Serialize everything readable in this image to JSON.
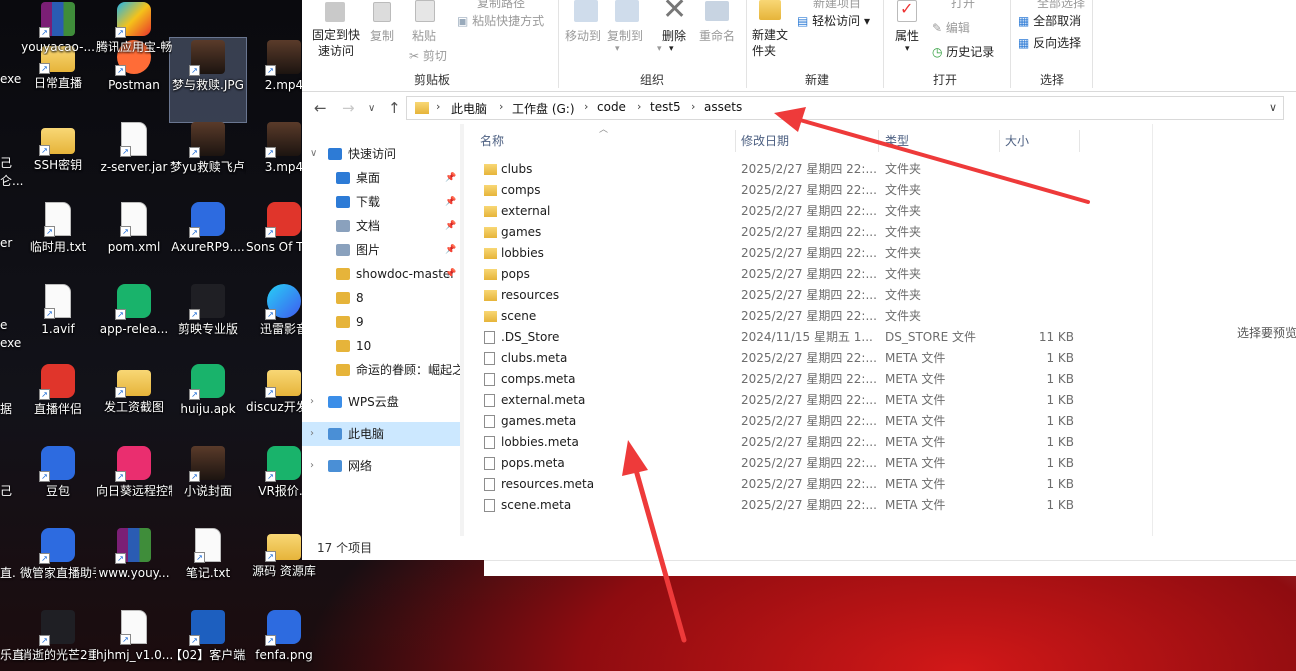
{
  "desktop": {
    "icons": [
      {
        "label": "日常直播",
        "type": "folder"
      },
      {
        "label": "Postman",
        "type": "orange"
      },
      {
        "label": "梦与救赎.JPG",
        "type": "img"
      },
      {
        "label": "2.mp4",
        "type": "img"
      },
      {
        "label": "SSH密钥",
        "type": "folder"
      },
      {
        "label": "z-server.jar",
        "type": "file"
      },
      {
        "label": "梦yu救赎飞卢.png",
        "type": "img"
      },
      {
        "label": "3.mp4",
        "type": "img"
      },
      {
        "label": "临时用.txt",
        "type": "file"
      },
      {
        "label": "pom.xml",
        "type": "file"
      },
      {
        "label": "AxureRP9....",
        "type": "blue"
      },
      {
        "label": "Sons Of The Forest",
        "type": "red"
      },
      {
        "label": "1.avif",
        "type": "file"
      },
      {
        "label": "app-relea...",
        "type": "green"
      },
      {
        "label": "剪映专业版",
        "type": "dark"
      },
      {
        "label": "迅雷影音",
        "type": "cyan"
      },
      {
        "label": "直播伴侣",
        "type": "red"
      },
      {
        "label": "发工资截图",
        "type": "folder"
      },
      {
        "label": "huiju.apk",
        "type": "green"
      },
      {
        "label": "discuz开发者中心",
        "type": "folder"
      },
      {
        "label": "豆包",
        "type": "blue"
      },
      {
        "label": "向日葵远程控制",
        "type": "pink"
      },
      {
        "label": "小说封面",
        "type": "img"
      },
      {
        "label": "VR报价.x",
        "type": "green"
      },
      {
        "label": "微管家直播助手",
        "type": "blue"
      },
      {
        "label": "www.youy...",
        "type": "rar"
      },
      {
        "label": "笔记.txt",
        "type": "file"
      },
      {
        "label": "源码 资源库",
        "type": "folder"
      },
      {
        "label": "消逝的光芒2重装上阵版",
        "type": "dark"
      },
      {
        "label": "hjhmj_v1.0...",
        "type": "file"
      },
      {
        "label": "【02】客户端服务端C...",
        "type": "word"
      },
      {
        "label": "fenfa.png",
        "type": "blue"
      },
      {
        "label": "youyacao-...",
        "type": "rar"
      },
      {
        "label": "腾讯应用宝-畅玩手机...",
        "type": "lt"
      }
    ],
    "edge_labels": [
      "exe",
      "己",
      "仑...",
      "er",
      "e",
      "exe",
      "据",
      "己",
      "直.",
      "乐直"
    ]
  },
  "ribbon": {
    "top_partial": [
      "复制路径",
      "新建项目",
      "打开",
      "全部选择"
    ],
    "pin": "固定到快速访问",
    "copy": "复制",
    "paste": "粘贴",
    "paste_shortcut": "粘贴快捷方式",
    "cut": "剪切",
    "move_to": "移动到",
    "copy_to": "复制到",
    "delete": "删除",
    "rename": "重命名",
    "new_folder": "新建文件夹",
    "easy_access": "轻松访问",
    "properties": "属性",
    "edit": "编辑",
    "history": "历史记录",
    "select_none": "全部取消",
    "invert": "反向选择",
    "groups": [
      "剪贴板",
      "组织",
      "新建",
      "打开",
      "选择"
    ]
  },
  "address": {
    "crumbs": [
      "此电脑",
      "工作盘 (G:)",
      "code",
      "test5",
      "assets"
    ]
  },
  "nav": {
    "items": [
      {
        "label": "快速访问",
        "kind": "quick",
        "indent": 0,
        "arrow": "open"
      },
      {
        "label": "桌面",
        "kind": "desktop",
        "indent": 1,
        "pin": true
      },
      {
        "label": "下载",
        "kind": "download",
        "indent": 1,
        "pin": true
      },
      {
        "label": "文档",
        "kind": "docs",
        "indent": 1,
        "pin": true
      },
      {
        "label": "图片",
        "kind": "pics",
        "indent": 1,
        "pin": true
      },
      {
        "label": "showdoc-master",
        "kind": "folder",
        "indent": 1,
        "pin": true
      },
      {
        "label": "8",
        "kind": "folder",
        "indent": 1
      },
      {
        "label": "9",
        "kind": "folder",
        "indent": 1
      },
      {
        "label": "10",
        "kind": "folder",
        "indent": 1
      },
      {
        "label": "命运的眷顾：崛起之路",
        "kind": "folder",
        "indent": 1
      },
      {
        "label": "WPS云盘",
        "kind": "cloud",
        "indent": 0,
        "arrow": "closed"
      },
      {
        "label": "此电脑",
        "kind": "pc",
        "indent": 0,
        "arrow": "closed",
        "selected": true
      },
      {
        "label": "网络",
        "kind": "net",
        "indent": 0,
        "arrow": "closed"
      }
    ]
  },
  "list": {
    "headers": [
      "名称",
      "修改日期",
      "类型",
      "大小"
    ],
    "rows": [
      {
        "name": "clubs",
        "date": "2025/2/27 星期四 22:...",
        "type": "文件夹",
        "size": "",
        "kind": "folder"
      },
      {
        "name": "comps",
        "date": "2025/2/27 星期四 22:...",
        "type": "文件夹",
        "size": "",
        "kind": "folder"
      },
      {
        "name": "external",
        "date": "2025/2/27 星期四 22:...",
        "type": "文件夹",
        "size": "",
        "kind": "folder"
      },
      {
        "name": "games",
        "date": "2025/2/27 星期四 22:...",
        "type": "文件夹",
        "size": "",
        "kind": "folder"
      },
      {
        "name": "lobbies",
        "date": "2025/2/27 星期四 22:...",
        "type": "文件夹",
        "size": "",
        "kind": "folder"
      },
      {
        "name": "pops",
        "date": "2025/2/27 星期四 22:...",
        "type": "文件夹",
        "size": "",
        "kind": "folder"
      },
      {
        "name": "resources",
        "date": "2025/2/27 星期四 22:...",
        "type": "文件夹",
        "size": "",
        "kind": "folder"
      },
      {
        "name": "scene",
        "date": "2025/2/27 星期四 22:...",
        "type": "文件夹",
        "size": "",
        "kind": "folder"
      },
      {
        "name": ".DS_Store",
        "date": "2024/11/15 星期五 1...",
        "type": "DS_STORE 文件",
        "size": "11 KB",
        "kind": "file"
      },
      {
        "name": "clubs.meta",
        "date": "2025/2/27 星期四 22:...",
        "type": "META 文件",
        "size": "1 KB",
        "kind": "file"
      },
      {
        "name": "comps.meta",
        "date": "2025/2/27 星期四 22:...",
        "type": "META 文件",
        "size": "1 KB",
        "kind": "file"
      },
      {
        "name": "external.meta",
        "date": "2025/2/27 星期四 22:...",
        "type": "META 文件",
        "size": "1 KB",
        "kind": "file"
      },
      {
        "name": "games.meta",
        "date": "2025/2/27 星期四 22:...",
        "type": "META 文件",
        "size": "1 KB",
        "kind": "file"
      },
      {
        "name": "lobbies.meta",
        "date": "2025/2/27 星期四 22:...",
        "type": "META 文件",
        "size": "1 KB",
        "kind": "file"
      },
      {
        "name": "pops.meta",
        "date": "2025/2/27 星期四 22:...",
        "type": "META 文件",
        "size": "1 KB",
        "kind": "file"
      },
      {
        "name": "resources.meta",
        "date": "2025/2/27 星期四 22:...",
        "type": "META 文件",
        "size": "1 KB",
        "kind": "file"
      },
      {
        "name": "scene.meta",
        "date": "2025/2/27 星期四 22:...",
        "type": "META 文件",
        "size": "1 KB",
        "kind": "file"
      }
    ]
  },
  "preview": {
    "text": "选择要预览"
  },
  "status": {
    "count": "17 个项目"
  },
  "colors": {
    "accent": "#0078d7",
    "selection": "#cce8ff",
    "folder": "#e6b43a",
    "annotation": "#ee3a3a"
  }
}
